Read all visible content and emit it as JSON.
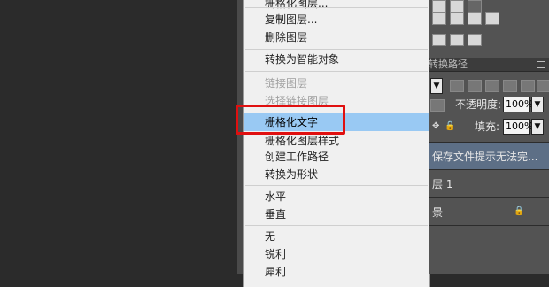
{
  "context_menu": {
    "items": [
      {
        "label": "栅格化图层...",
        "state": "normal"
      },
      {
        "label": "复制图层...",
        "state": "normal"
      },
      {
        "label": "删除图层",
        "state": "normal"
      },
      {
        "label": "转换为智能对象",
        "state": "normal"
      },
      {
        "label": "链接图层",
        "state": "disabled"
      },
      {
        "label": "选择链接图层",
        "state": "disabled"
      },
      {
        "label": "栅格化文字",
        "state": "selected"
      },
      {
        "label": "栅格化图层样式",
        "state": "normal"
      },
      {
        "label": "创建工作路径",
        "state": "normal"
      },
      {
        "label": "转换为形状",
        "state": "normal"
      },
      {
        "label": "水平",
        "state": "normal"
      },
      {
        "label": "垂直",
        "state": "normal"
      },
      {
        "label": "无",
        "state": "normal"
      },
      {
        "label": "锐利",
        "state": "normal"
      },
      {
        "label": "犀利",
        "state": "normal"
      }
    ]
  },
  "panel": {
    "tab_label": "转换路径",
    "opacity_label": "不透明度:",
    "opacity_value": "100%",
    "fill_label": "填充:",
    "fill_value": "100%",
    "layers": [
      {
        "name": "保存文件提示无法完...",
        "selected": true
      },
      {
        "name": "层 1",
        "selected": false
      },
      {
        "name": "景",
        "selected": false
      }
    ]
  },
  "colors": {
    "highlight_border": "#e01010",
    "menu_selected_bg": "#99c9f3",
    "layer_selected_bg": "#5d6f86"
  }
}
